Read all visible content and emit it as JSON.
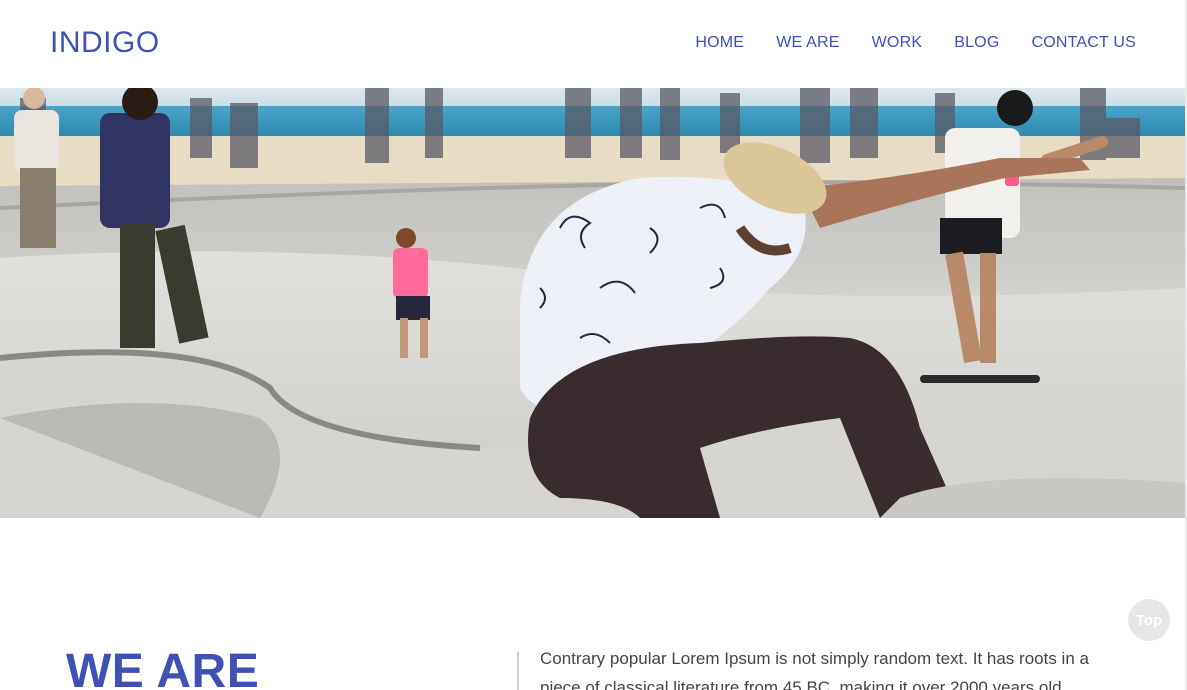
{
  "brand": {
    "logo": "INDIGO",
    "accent_color": "#3f51b5"
  },
  "nav": {
    "items": [
      "HOME",
      "WE ARE",
      "WORK",
      "BLOG",
      "CONTACT US"
    ]
  },
  "hero": {
    "image": "skatepark-photo",
    "alt": "Skateboarder mid-air at a concrete skate park with spectators and beach in background"
  },
  "about": {
    "title": "WE ARE",
    "text": "Contrary popular Lorem Ipsum is not simply random text. It has roots in a piece of classical literature from 45 BC, making it over 2000 years old."
  },
  "back_to_top": {
    "label": "Top"
  }
}
